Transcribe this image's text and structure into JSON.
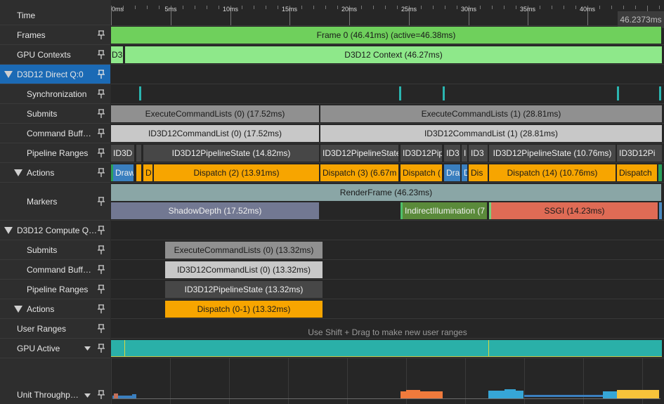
{
  "time_header": {
    "label": "Time",
    "cursor_value": "46.2373ms",
    "ticks": [
      "0ms",
      "5ms",
      "10ms",
      "15ms",
      "20ms",
      "25ms",
      "30ms",
      "35ms",
      "40ms"
    ]
  },
  "rows": {
    "frames": "Frames",
    "gpu_contexts": "GPU Contexts",
    "direct_queue": "D3D12 Direct Q:0",
    "synchronization": "Synchronization",
    "submits": "Submits",
    "command_buffers": "Command Buff…",
    "pipeline_ranges": "Pipeline Ranges",
    "actions": "Actions",
    "markers": "Markers",
    "compute_queue": "D3D12 Compute Q…",
    "c_submits": "Submits",
    "c_command_buffers": "Command Buff…",
    "c_pipeline_ranges": "Pipeline Ranges",
    "c_actions": "Actions",
    "user_ranges": "User Ranges",
    "gpu_active": "GPU Active",
    "unit_throughput": "Unit Throughp…"
  },
  "frames": {
    "frame0": "Frame 0 (46.41ms) (active=46.38ms)"
  },
  "gpu_contexts": {
    "small": "D3",
    "main": "D3D12 Context (46.27ms)"
  },
  "submits": {
    "s0": "ExecuteCommandLists (0) (17.52ms)",
    "s1": "ExecuteCommandLists (1) (28.81ms)"
  },
  "command_lists": {
    "c0": "ID3D12CommandList (0) (17.52ms)",
    "c1": "ID3D12CommandList (1) (28.81ms)"
  },
  "pipelines": {
    "p1": "ID3D",
    "p2": "ID3D12PipelineState (14.82ms)",
    "p3": "ID3D12PipelineState",
    "p4": "ID3D12Pip",
    "p5": "ID3",
    "p6": "I",
    "p7": "ID3",
    "p8": "ID3D12PipelineState (10.76ms)",
    "p9": "ID3D12Pi"
  },
  "actions": {
    "a1": "Draw",
    "a2": "D",
    "a3": "Dispatch (2) (13.91ms)",
    "a4": "Dispatch (3) (6.67m",
    "a5": "Dispatch (",
    "a6": "Dra",
    "a7": "D",
    "a8": "Dis",
    "a9": "Dispatch (14) (10.76ms)",
    "a10": "Dispatch"
  },
  "markers": {
    "render_frame": "RenderFrame (46.23ms)",
    "shadow_depth": "ShadowDepth (17.52ms)",
    "indirect": "IndirectIllumination (7",
    "ssgi": "SSGI (14.23ms)"
  },
  "compute": {
    "submit": "ExecuteCommandLists (0) (13.32ms)",
    "cmdlist": "ID3D12CommandList (0) (13.32ms)",
    "pipeline": "ID3D12PipelineState (13.32ms)",
    "action": "Dispatch (0-1) (13.32ms)"
  },
  "user_ranges_hint": "Use Shift + Drag to make new user ranges",
  "colors": {
    "frames": "#6fd05c",
    "context": "#8ee88a",
    "submit": "#909090",
    "cmdlist": "#c8c8c8",
    "pipeline": "#474747",
    "dispatch": "#f7a500",
    "draw": "#3a7fbf",
    "render_frame": "#8aa6a6",
    "shadow": "#727892",
    "indirect": "#5a8a3a",
    "ssgi": "#df6b55",
    "gpu_active": "#2ab0a8",
    "selected": "#1b6ab5"
  }
}
